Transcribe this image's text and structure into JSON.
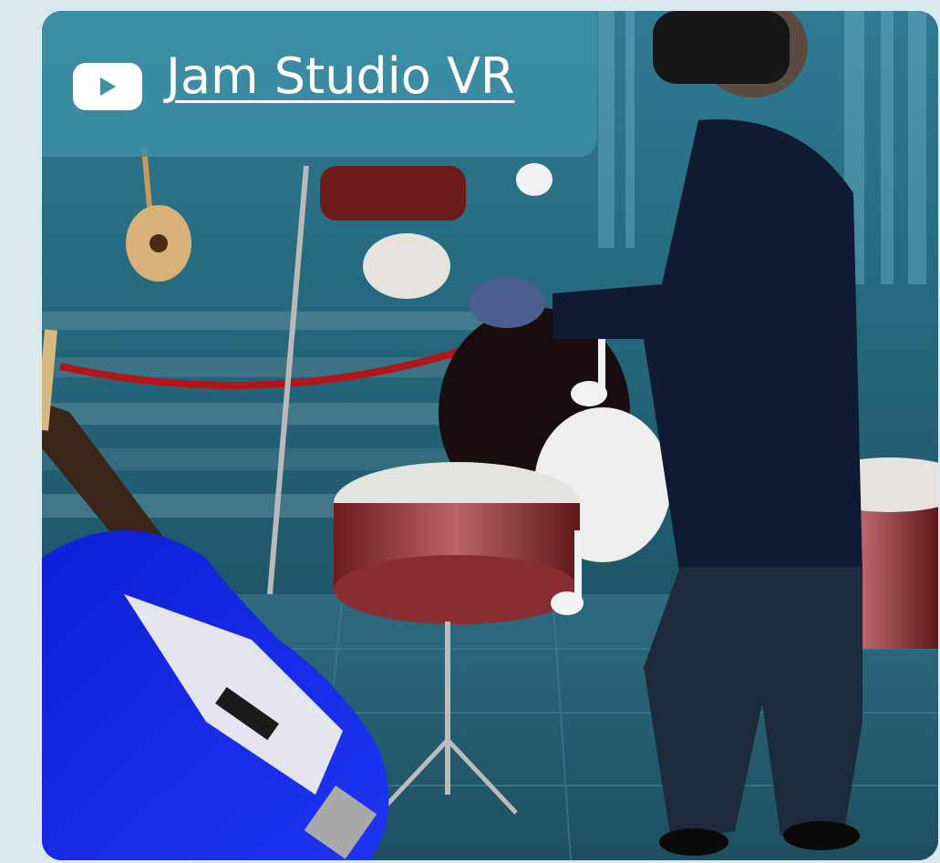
{
  "card": {
    "title": "Jam Studio VR"
  },
  "icons": {
    "play": "youtube-play-icon"
  },
  "colors": {
    "page_background": "#dbe9ef",
    "overlay": "#3e8fa6",
    "title_text": "#ffffff"
  }
}
